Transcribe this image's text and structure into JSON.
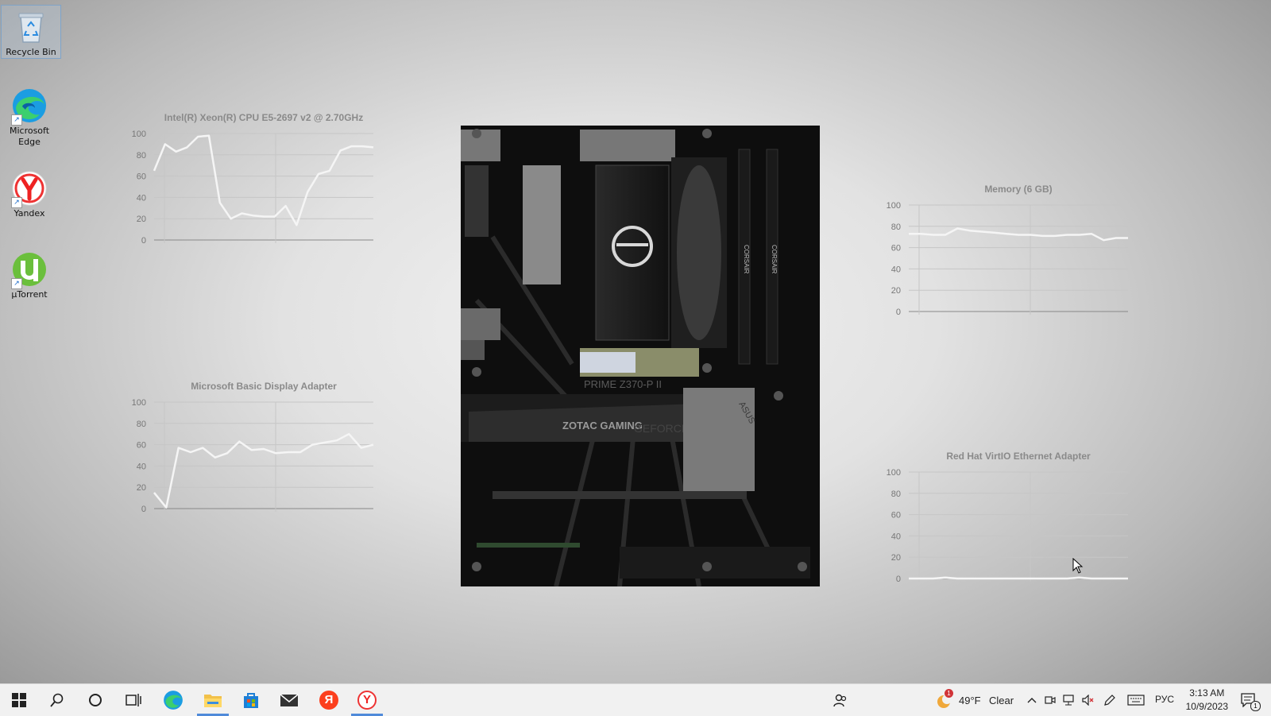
{
  "desktop_icons": [
    {
      "label": "Recycle Bin",
      "icon": "recycle-bin-icon"
    },
    {
      "label": "Microsoft Edge",
      "icon": "edge-icon"
    },
    {
      "label": "Yandex",
      "icon": "yandex-browser-icon"
    },
    {
      "label": "μTorrent",
      "icon": "utorrent-icon"
    }
  ],
  "charts": [
    {
      "title": "Intel(R) Xeon(R) CPU E5-2697 v2 @ 2.70GHz",
      "yticks": [
        "100",
        "80",
        "60",
        "40",
        "20",
        "0"
      ],
      "ylim": [
        0,
        100
      ],
      "values": [
        65,
        90,
        83,
        87,
        97,
        98,
        35,
        20,
        25,
        23,
        22,
        22,
        32,
        14,
        45,
        62,
        65,
        84,
        88,
        88,
        87
      ],
      "line_color": "#f5f5f5"
    },
    {
      "title": "Microsoft Basic Display Adapter",
      "yticks": [
        "100",
        "80",
        "60",
        "40",
        "20",
        "0"
      ],
      "ylim": [
        0,
        100
      ],
      "values": [
        15,
        1,
        57,
        53,
        57,
        48,
        52,
        63,
        55,
        56,
        52,
        53,
        53,
        60,
        62,
        64,
        70,
        57,
        60
      ],
      "line_color": "#f5f5f5"
    },
    {
      "title": "Memory (6 GB)",
      "yticks": [
        "100",
        "80",
        "60",
        "40",
        "20",
        "0"
      ],
      "ylim": [
        0,
        100
      ],
      "values": [
        73,
        73,
        72,
        72,
        78,
        76,
        75,
        74,
        73,
        72,
        72,
        71,
        71,
        72,
        72,
        73,
        67,
        69,
        69
      ],
      "line_color": "#f5f5f5"
    },
    {
      "title": "Red Hat VirtIO Ethernet Adapter",
      "yticks": [
        "100",
        "80",
        "60",
        "40",
        "20",
        "0"
      ],
      "ylim": [
        0,
        100
      ],
      "values": [
        0,
        0,
        0,
        1,
        0,
        0,
        0,
        0,
        0,
        0,
        0,
        0,
        0,
        0,
        1,
        0,
        0,
        0,
        0
      ],
      "line_color": "#f5f5f5"
    }
  ],
  "motherboard": {
    "labels": [
      "PRIME Z370-P II",
      "ZOTAC GAMING",
      "GEFORCE GTX",
      "CORSAIR",
      "CORSAIR",
      "ASUS"
    ]
  },
  "taskbar": {
    "apps": [
      {
        "name": "start-button",
        "icon": "windows-start-icon"
      },
      {
        "name": "search-button",
        "icon": "search-icon"
      },
      {
        "name": "cortana-button",
        "icon": "cortana-circle-icon"
      },
      {
        "name": "task-view-button",
        "icon": "task-view-icon"
      },
      {
        "name": "taskbar-edge",
        "icon": "edge-icon"
      },
      {
        "name": "taskbar-file-explorer",
        "icon": "folder-icon"
      },
      {
        "name": "taskbar-store",
        "icon": "store-icon"
      },
      {
        "name": "taskbar-mail",
        "icon": "mail-icon"
      },
      {
        "name": "taskbar-yandex",
        "icon": "yandex-icon",
        "glyph": "Я"
      },
      {
        "name": "taskbar-yandex-browser",
        "icon": "yandex-browser-icon",
        "glyph": "Y"
      }
    ],
    "weather": {
      "temp": "49°F",
      "condition": "Clear",
      "badge": "1"
    },
    "language": "РУС",
    "time": "3:13 AM",
    "date": "10/9/2023",
    "notifications": "1"
  }
}
